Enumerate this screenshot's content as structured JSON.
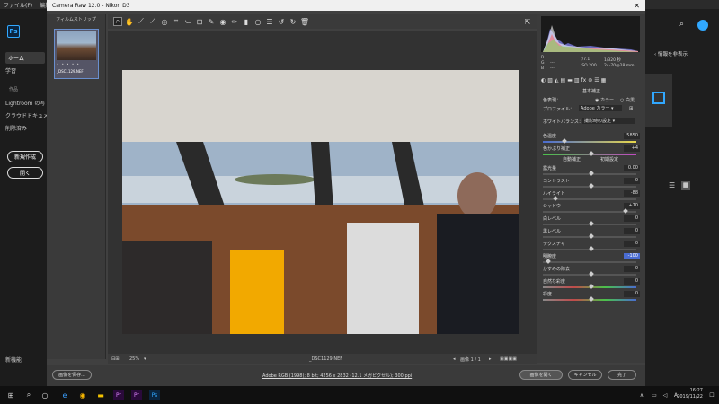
{
  "ps": {
    "menu": [
      "ファイル(F)",
      "編集"
    ],
    "logo": "Ps",
    "nav": [
      {
        "label": "ホーム"
      },
      {
        "label": "学習"
      }
    ],
    "section": "作品",
    "items": [
      "Lightroom の写",
      "クラウドドキュメン",
      "削除済み"
    ],
    "new_btn": "新規作成",
    "open_btn": "開く",
    "new_features": "新機能",
    "right_info": "情報を非表示"
  },
  "dialog": {
    "title": "Camera Raw 12.0 - Nikon D3",
    "filmstrip_title": "フィルムストリップ",
    "thumb_name": "_DSC1129.NEF",
    "thumb_dots": "• • • • •",
    "zoom": "25%",
    "filename": "_DSC1129.NEF",
    "image_count": "画像 1 / 1",
    "histogram": {
      "r": "R :",
      "g": "G :",
      "b": "B :",
      "dash": "---",
      "aperture": "f/7.1",
      "shutter": "1/320 秒",
      "iso": "ISO 200",
      "focal": "24-70@28 mm"
    },
    "panel_title": "基本補正",
    "treatment": "色表現：",
    "color": "カラー",
    "mono": "白黒",
    "profile_label": "プロファイル：",
    "profile": "Adobe カラー",
    "wb_label": "ホワイトバランス：",
    "wb_value": "撮影時の設定",
    "auto": "自動補正",
    "default": "初期設定",
    "sliders": [
      {
        "label": "色温度",
        "value": "5850"
      },
      {
        "label": "色かぶり補正",
        "value": "+4"
      },
      {
        "label": "露光量",
        "value": "0.00"
      },
      {
        "label": "コントラスト",
        "value": "0"
      },
      {
        "label": "ハイライト",
        "value": "-88"
      },
      {
        "label": "シャドウ",
        "value": "+70"
      },
      {
        "label": "白レベル",
        "value": "0"
      },
      {
        "label": "黒レベル",
        "value": "0"
      },
      {
        "label": "テクスチャ",
        "value": "0"
      },
      {
        "label": "明瞭度",
        "value": "-100"
      },
      {
        "label": "かすみの除去",
        "value": "0"
      },
      {
        "label": "自然な彩度",
        "value": "0"
      },
      {
        "label": "彩度",
        "value": "0"
      }
    ],
    "save_btn": "画像を保存...",
    "workflow_link": "Adobe RGB (1998); 8 bit; 4256 x 2832 (12.1 メガピクセル); 300 ppi",
    "open_image_btn": "画像を開く",
    "cancel_btn": "キャンセル",
    "done_btn": "完了"
  },
  "taskbar": {
    "time": "16:27",
    "date": "2019/11/22"
  },
  "colors": {
    "accent": "#4a6cd1",
    "ps_blue": "#31a8ff"
  }
}
